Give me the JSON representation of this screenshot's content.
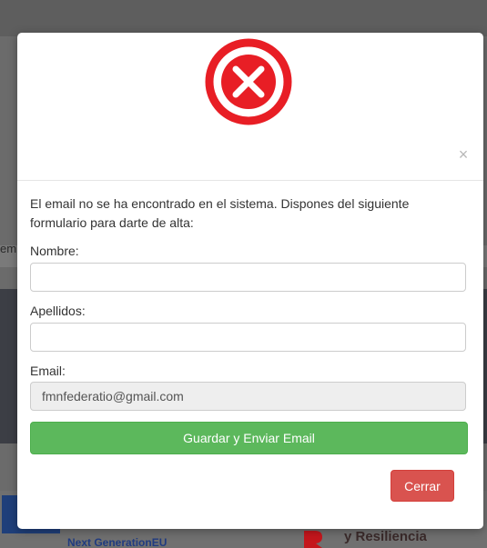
{
  "background": {
    "left_fragment": "em",
    "footer_left": "Next GenerationEU",
    "footer_right": "y Resiliencia"
  },
  "modal": {
    "icon": "error-x-circle-icon",
    "close_symbol": "×",
    "message": "El email no se ha encontrado en el sistema. Dispones del siguiente formulario para darte de alta:",
    "fields": {
      "nombre": {
        "label": "Nombre:",
        "value": ""
      },
      "apellidos": {
        "label": "Apellidos:",
        "value": ""
      },
      "email": {
        "label": "Email:",
        "value": "fmnfederatio@gmail.com"
      }
    },
    "submit_label": "Guardar y Enviar Email",
    "close_label": "Cerrar"
  },
  "colors": {
    "error_red": "#e81e25",
    "success_green": "#5cb85c",
    "danger_red": "#d9534f"
  }
}
